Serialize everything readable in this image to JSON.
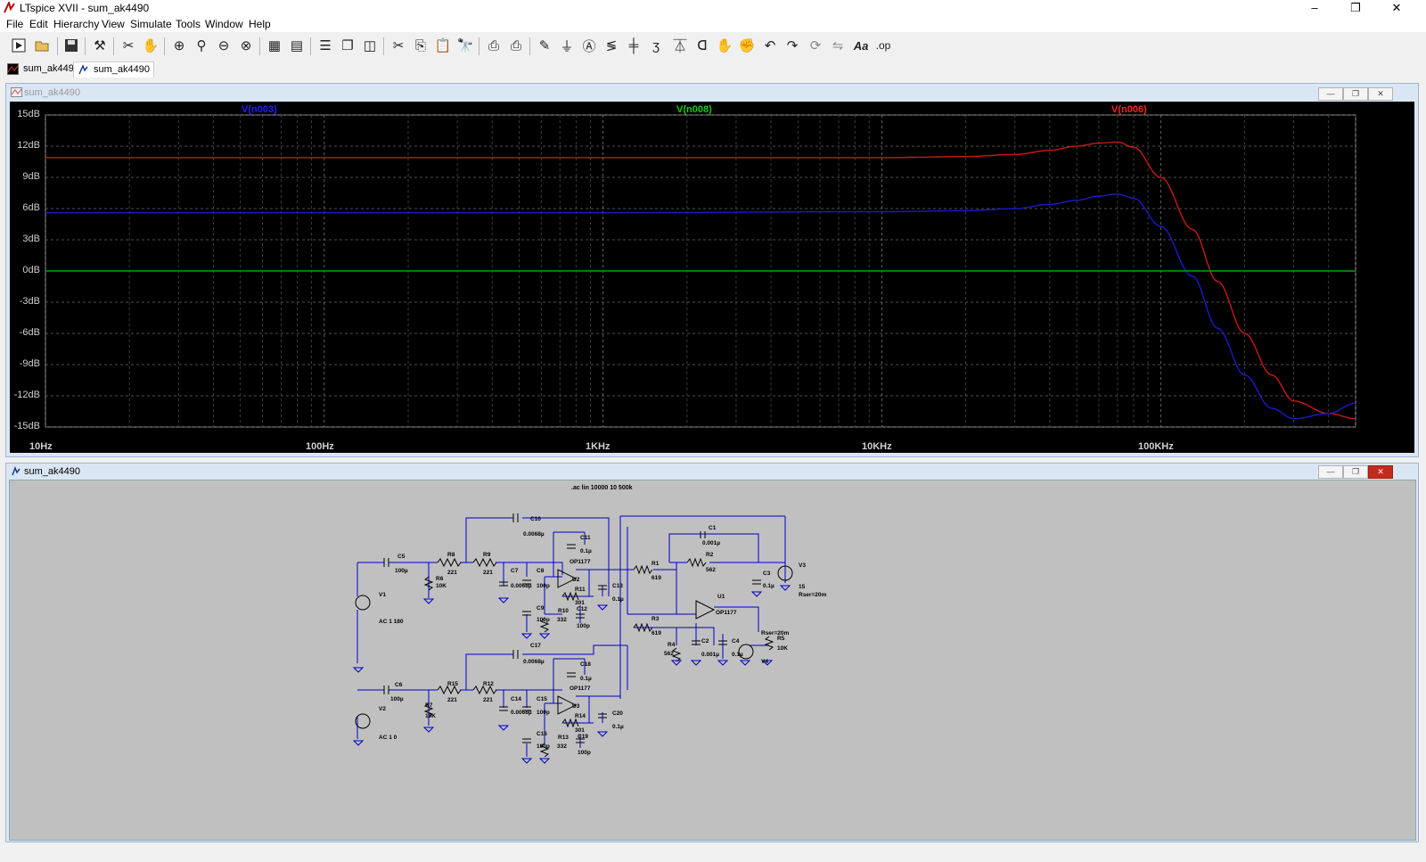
{
  "app": {
    "title": "LTspice XVII - sum_ak4490",
    "window_controls": {
      "minimize": "–",
      "restore": "❐",
      "close": "✕"
    }
  },
  "menu": [
    "File",
    "Edit",
    "Hierarchy",
    "View",
    "Simulate",
    "Tools",
    "Window",
    "Help"
  ],
  "toolbar": {
    "icons": [
      "run-icon",
      "open-icon",
      "save-icon",
      "control-panel-icon",
      "halt-icon",
      "pan-icon",
      "zoom-in-icon",
      "zoom-area-icon",
      "zoom-out-icon",
      "zoom-fit-icon",
      "autorange-icon",
      "plot-settings-icon",
      "tile-horizontal-icon",
      "cascade-icon",
      "tile-vertical-icon",
      "cut-icon",
      "copy-icon",
      "paste-icon",
      "find-icon",
      "print-icon",
      "print-preview-icon",
      "draw-wire-icon",
      "ground-icon",
      "label-icon",
      "resistor-icon",
      "capacitor-icon",
      "inductor-icon",
      "diode-icon",
      "component-icon",
      "move-icon",
      "drag-icon",
      "undo-icon",
      "redo-icon",
      "rotate-icon",
      "mirror-icon",
      "text-icon",
      "spice-directive-icon"
    ],
    "text_glyphs": {
      "text": "Aa",
      "spice": ".op"
    }
  },
  "tabs": [
    {
      "label": "sum_ak4490",
      "kind": "waveform"
    },
    {
      "label": "sum_ak4490",
      "kind": "schematic",
      "active": true
    }
  ],
  "plot_window": {
    "title": "sum_ak4490",
    "traces": [
      {
        "name": "V(n003)",
        "color": "#2020ff"
      },
      {
        "name": "V(n008)",
        "color": "#00d000"
      },
      {
        "name": "V(n006)",
        "color": "#ff2020"
      }
    ],
    "y_ticks": [
      "15dB",
      "12dB",
      "9dB",
      "6dB",
      "3dB",
      "0dB",
      "-3dB",
      "-6dB",
      "-9dB",
      "-12dB",
      "-15dB"
    ],
    "x_ticks": [
      "10Hz",
      "100Hz",
      "1KHz",
      "10KHz",
      "100KHz"
    ]
  },
  "chart_data": {
    "type": "line",
    "x_scale": "log",
    "xlim": [
      10,
      500000
    ],
    "ylim": [
      -15,
      15
    ],
    "series": [
      {
        "name": "V(n006)",
        "color": "#cc1818",
        "x": [
          10,
          1000,
          10000,
          20000,
          30000,
          40000,
          50000,
          60000,
          70000,
          80000,
          100000,
          130000,
          160000,
          200000,
          250000,
          300000,
          400000,
          500000
        ],
        "y": [
          10.9,
          10.9,
          10.9,
          11.0,
          11.2,
          11.6,
          12.0,
          12.3,
          12.4,
          11.9,
          9.0,
          4.0,
          -1.0,
          -6.0,
          -10.0,
          -12.5,
          -13.7,
          -14.2
        ]
      },
      {
        "name": "V(n003)",
        "color": "#1a1acc",
        "x": [
          10,
          1000,
          10000,
          20000,
          30000,
          40000,
          50000,
          60000,
          70000,
          80000,
          100000,
          130000,
          160000,
          200000,
          250000,
          300000,
          400000,
          500000
        ],
        "y": [
          5.6,
          5.6,
          5.7,
          5.8,
          6.0,
          6.4,
          6.8,
          7.2,
          7.4,
          7.0,
          4.3,
          -0.5,
          -5.5,
          -10.0,
          -13.2,
          -14.2,
          -13.7,
          -12.7
        ]
      },
      {
        "name": "V(n008)",
        "color": "#00a000",
        "x": [
          10,
          500000
        ],
        "y": [
          0,
          0
        ]
      }
    ]
  },
  "schematic_window": {
    "title": "sum_ak4490",
    "directive": ".ac lin 10000 10 500k",
    "labels": {
      "C5": "C5",
      "C5v": "100µ",
      "R6": "R6",
      "R6v": "10K",
      "V1": "V1",
      "V1v": "AC 1 180",
      "R8": "R8",
      "R8v": "221",
      "R9": "R9",
      "R9v": "221",
      "C7": "C7",
      "C7v": "0.0068µ",
      "C8": "C8",
      "C8v": "100p",
      "C9": "C9",
      "C9v": "100p",
      "R10": "R10",
      "R10v": "332",
      "C10": "C10",
      "C10v": "0.0068µ",
      "C11": "C11",
      "C11v": "0.1µ",
      "U2": "U2",
      "U2m": "OP1177",
      "R11": "R11",
      "R11v": "301",
      "C12": "C12",
      "C12v": "100p",
      "C13": "C13",
      "C13v": "0.1µ",
      "R1": "R1",
      "R1v": "619",
      "R2": "R2",
      "R2v": "562",
      "C1": "C1",
      "C1v": "0.001µ",
      "U1": "U1",
      "U1m": "OP1177",
      "C3": "C3",
      "C3v": "0.1µ",
      "V3": "V3",
      "V3v": "15",
      "V3r": "Rser=20m",
      "R3": "R3",
      "R3v": "619",
      "R4": "R4",
      "R4v": "562",
      "C2": "C2",
      "C2v": "0.001µ",
      "C4": "C4",
      "C4v": "0.1µ",
      "V4": "V4",
      "V4r": "Rser=20m",
      "R5": "R5",
      "R5v": "10K",
      "C17": "C17",
      "C17v": "0.0068µ",
      "C18": "C18",
      "C18v": "0.1µ",
      "U3": "U3",
      "U3m": "OP1177",
      "C6": "C6",
      "C6v": "100µ",
      "R7": "R7",
      "R7v": "10K",
      "V2": "V2",
      "V2v": "AC 1 0",
      "R15": "R15",
      "R15v": "221",
      "R12": "R12",
      "R12v": "221",
      "C14": "C14",
      "C14v": "0.0068µ",
      "C15": "C15",
      "C15v": "100p",
      "C16": "C16",
      "C16v": "100p",
      "R13": "R13",
      "R13v": "332",
      "R14": "R14",
      "R14v": "301",
      "C19": "C19",
      "C19v": "100p",
      "C20": "C20",
      "C20v": "0.1µ"
    }
  }
}
